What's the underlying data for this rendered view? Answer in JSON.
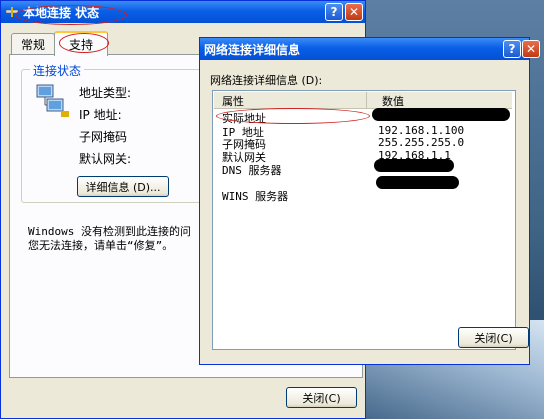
{
  "status_window": {
    "title": "本地连接 状态",
    "tabs": [
      {
        "label": "常规"
      },
      {
        "label": "支持"
      }
    ],
    "group_title": "连接状态",
    "address_type_label": "地址类型:",
    "ip_label": "IP 地址:",
    "subnet_label": "子网掩码",
    "gateway_label": "默认网关:",
    "details_button": "详细信息 (D)...",
    "message_line1": "Windows 没有检测到此连接的问",
    "message_line2": "您无法连接，请单击“修复”。",
    "close_button": "关闭(C)"
  },
  "details_window": {
    "title": "网络连接详细信息",
    "list_label": "网络连接详细信息 (D):",
    "columns": {
      "property": "属性",
      "value": "数值"
    },
    "rows": [
      {
        "property": "实际地址",
        "value": ""
      },
      {
        "property": "IP 地址",
        "value": "192.168.1.100"
      },
      {
        "property": "子网掩码",
        "value": "255.255.255.0"
      },
      {
        "property": "默认网关",
        "value": "192.168.1.1"
      },
      {
        "property": "DNS 服务器",
        "value": ""
      },
      {
        "property": "",
        "value": ""
      },
      {
        "property": "WINS 服务器",
        "value": ""
      }
    ],
    "close_button": "关闭(C)"
  },
  "colors": {
    "titlebar": "#0a5fe6",
    "window_bg": "#ece9d8",
    "annotation_red": "#d02020",
    "redaction": "#000000"
  }
}
